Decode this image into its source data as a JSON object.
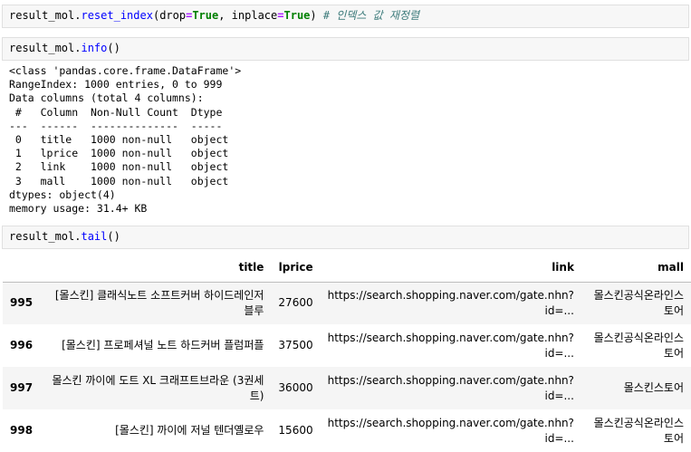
{
  "cells": [
    {
      "tokens": [
        {
          "t": "result_mol.",
          "c": ""
        },
        {
          "t": "reset_index",
          "c": "fn"
        },
        {
          "t": "(drop",
          "c": ""
        },
        {
          "t": "=",
          "c": "op"
        },
        {
          "t": "True",
          "c": "kw"
        },
        {
          "t": ", inplace",
          "c": ""
        },
        {
          "t": "=",
          "c": "op"
        },
        {
          "t": "True",
          "c": "kw"
        },
        {
          "t": ") ",
          "c": ""
        },
        {
          "t": "# 인덱스 값 재정렬",
          "c": "cm"
        }
      ]
    },
    {
      "tokens": [
        {
          "t": "result_mol.",
          "c": ""
        },
        {
          "t": "info",
          "c": "fn"
        },
        {
          "t": "()",
          "c": ""
        }
      ]
    },
    {
      "tokens": [
        {
          "t": "result_mol.",
          "c": ""
        },
        {
          "t": "tail",
          "c": "fn"
        },
        {
          "t": "()",
          "c": ""
        }
      ]
    }
  ],
  "info_output": [
    "<class 'pandas.core.frame.DataFrame'>",
    "RangeIndex: 1000 entries, 0 to 999",
    "Data columns (total 4 columns):",
    " #   Column  Non-Null Count  Dtype ",
    "---  ------  --------------  ----- ",
    " 0   title   1000 non-null   object",
    " 1   lprice  1000 non-null   object",
    " 2   link    1000 non-null   object",
    " 3   mall    1000 non-null   object",
    "dtypes: object(4)",
    "memory usage: 31.4+ KB"
  ],
  "table": {
    "columns": [
      "",
      "title",
      "lprice",
      "link",
      "mall"
    ],
    "rows": [
      {
        "index": "995",
        "title": "[몰스킨] 클래식노트 소프트커버 하이드레인저블루",
        "lprice": "27600",
        "link": "https://search.shopping.naver.com/gate.nhn?id=...",
        "mall": "몰스킨공식온라인스토어"
      },
      {
        "index": "996",
        "title": "[몰스킨] 프로페셔널 노트 하드커버 플럼퍼플",
        "lprice": "37500",
        "link": "https://search.shopping.naver.com/gate.nhn?id=...",
        "mall": "몰스킨공식온라인스토어"
      },
      {
        "index": "997",
        "title": "몰스킨 까이에 도트 XL 크래프트브라운 (3권세트)",
        "lprice": "36000",
        "link": "https://search.shopping.naver.com/gate.nhn?id=...",
        "mall": "몰스킨스토어"
      },
      {
        "index": "998",
        "title": "[몰스킨] 까이에 저널 텐더옐로우",
        "lprice": "15600",
        "link": "https://search.shopping.naver.com/gate.nhn?id=...",
        "mall": "몰스킨공식온라인스토어"
      }
    ]
  }
}
